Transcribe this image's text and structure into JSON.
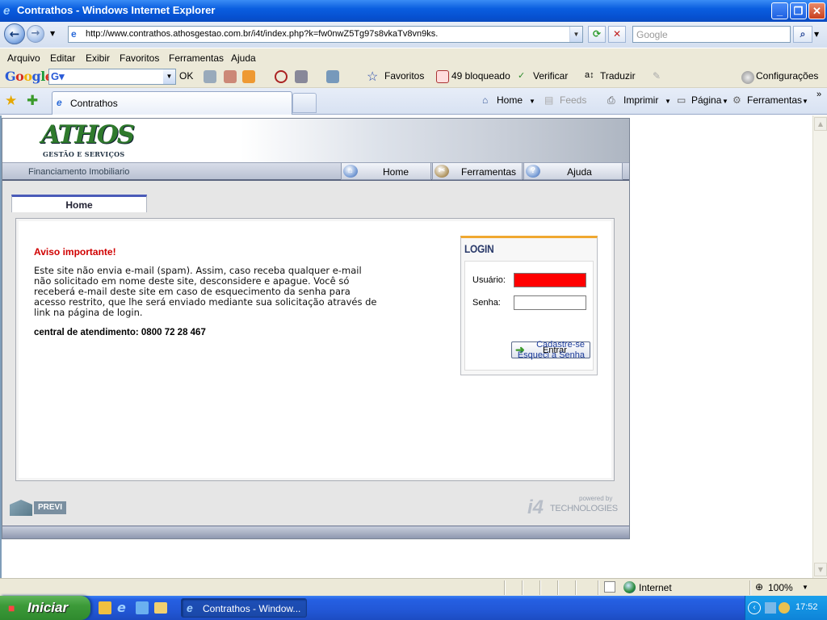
{
  "window": {
    "title": "Contrathos - Windows Internet Explorer"
  },
  "address": {
    "url": "http://www.contrathos.athosgestao.com.br/i4t/index.php?k=fw0nwZ5Tg97s8vkaTv8vn9ks.",
    "search_placeholder": "Google"
  },
  "menu": [
    "Arquivo",
    "Editar",
    "Exibir",
    "Favoritos",
    "Ferramentas",
    "Ajuda"
  ],
  "google_toolbar": {
    "logo": "Google",
    "ok": "OK",
    "favoritos": "Favoritos",
    "bloqueado": "49 bloqueado",
    "verificar": "Verificar",
    "traduzir": "Traduzir",
    "configuracoes": "Configurações"
  },
  "tabs": {
    "current": "Contrathos"
  },
  "commands": {
    "home": "Home",
    "feeds": "Feeds",
    "imprimir": "Imprimir",
    "pagina": "Página",
    "ferramentas": "Ferramentas"
  },
  "site": {
    "logo": "ATHOS",
    "logo_sub": "GESTÃO E SERVIÇOS",
    "slogan": "Financiamento Imobiliario",
    "nav": [
      "Home",
      "Ferramentas",
      "Ajuda"
    ],
    "tab": "Home",
    "aviso": "Aviso importante!",
    "message": "Este site não envia e-mail (spam). Assim, caso receba qualquer e-mail não solicitado em nome deste site, desconsidere e apague. Você só receberá e-mail deste site em caso de esquecimento da senha para acesso restrito, que lhe será enviado mediante sua solicitação através de link na página de login.",
    "central": "central de atendimento: 0800 72 28 467",
    "login": {
      "title": "LOGIN",
      "usuario_label": "Usuário:",
      "senha_label": "Senha:",
      "usuario_value": "",
      "senha_value": "",
      "entrar": "Entrar",
      "cadastre": "Cadastre-se",
      "esqueci": "Esqueci a Senha",
      "usuario_bg": "#ff0000"
    },
    "footer": {
      "previ": "PREVI",
      "powered": "powered by",
      "i4t": "TECHNOLOGIES"
    }
  },
  "status": {
    "zone": "Internet",
    "zoom": "100%"
  },
  "taskbar": {
    "start": "Iniciar",
    "item": "Contrathos - Window...",
    "clock": "17:52"
  }
}
